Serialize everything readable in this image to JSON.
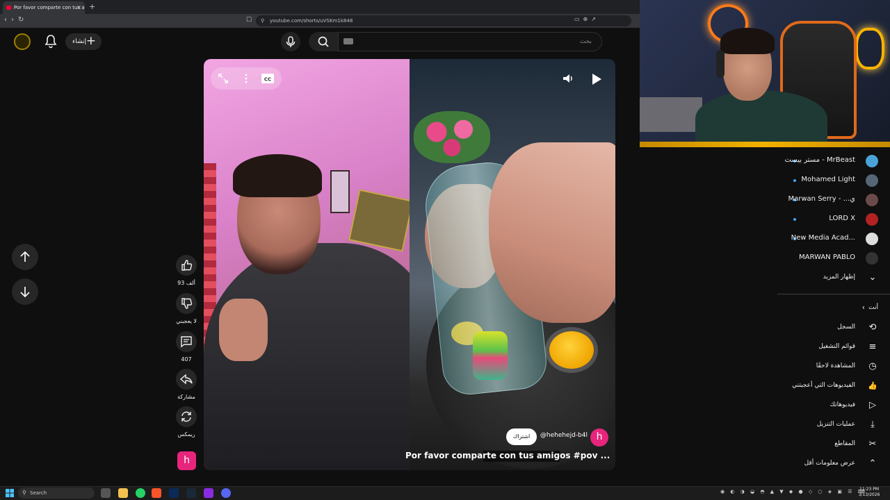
{
  "browser": {
    "tab_title": "Por favor comparte con tus amigos",
    "tab_close": "×",
    "new_tab": "+",
    "url": "youtube.com/shorts/uVSKm1k848"
  },
  "header": {
    "create_label": "إنشاء",
    "create_plus": "+",
    "search_placeholder": "بحث"
  },
  "actions": {
    "like_count": "93 ألف",
    "dislike_label": "لا يعجبني",
    "comment_count": "407",
    "share_label": "مشاركة",
    "remix_label": "ريمكس",
    "channel_initial": "h"
  },
  "video": {
    "channel_name": "@hehehejd-b4l",
    "channel_initial": "h",
    "subscribe_label": "اشتراك",
    "title": "Por favor comparte con tus amigos #pov ..."
  },
  "sidebar": {
    "subscriptions": [
      {
        "name": "مستر بيست - MrBeast",
        "avatar_color": "#4aa3d8",
        "new": true
      },
      {
        "name": "Mohamed Light",
        "avatar_color": "#556677",
        "new": true
      },
      {
        "name": "Marwan Serry - ...ي",
        "avatar_color": "#6a4a4a",
        "new": true
      },
      {
        "name": "LORD X",
        "avatar_color": "#b22222",
        "new": true
      },
      {
        "name": "New Media Acad...",
        "avatar_color": "#dddddd",
        "new": true
      },
      {
        "name": "MARWAN PABLO",
        "avatar_color": "#333333",
        "new": false
      }
    ],
    "show_more": "إظهار المزيد",
    "you_section": "أنت",
    "menu": [
      {
        "label": "السجل",
        "icon": "history-icon",
        "glyph": "⟲"
      },
      {
        "label": "قوائم التشغيل",
        "icon": "playlists-icon",
        "glyph": "≡"
      },
      {
        "label": "المشاهدة لاحقًا",
        "icon": "watch-later-icon",
        "glyph": "◷"
      },
      {
        "label": "الفيديوهات التي أعجبتني",
        "icon": "liked-icon",
        "glyph": "👍"
      },
      {
        "label": "فيديوهاتك",
        "icon": "your-videos-icon",
        "glyph": "▷"
      },
      {
        "label": "عمليات التنزيل",
        "icon": "downloads-icon",
        "glyph": "⤓"
      },
      {
        "label": "المقاطع",
        "icon": "clips-icon",
        "glyph": "✂"
      },
      {
        "label": "عرض معلومات أقل",
        "icon": "chevron-up-icon",
        "glyph": "⌃"
      }
    ]
  },
  "taskbar": {
    "search_label": "Search",
    "time": "11:23 PM",
    "date": "3/13/2026"
  },
  "colors": {
    "accent_red": "#ff0033",
    "channel_pink": "#e7257d",
    "new_dot": "#3ea6ff",
    "webcam_border": "#f2b100"
  }
}
